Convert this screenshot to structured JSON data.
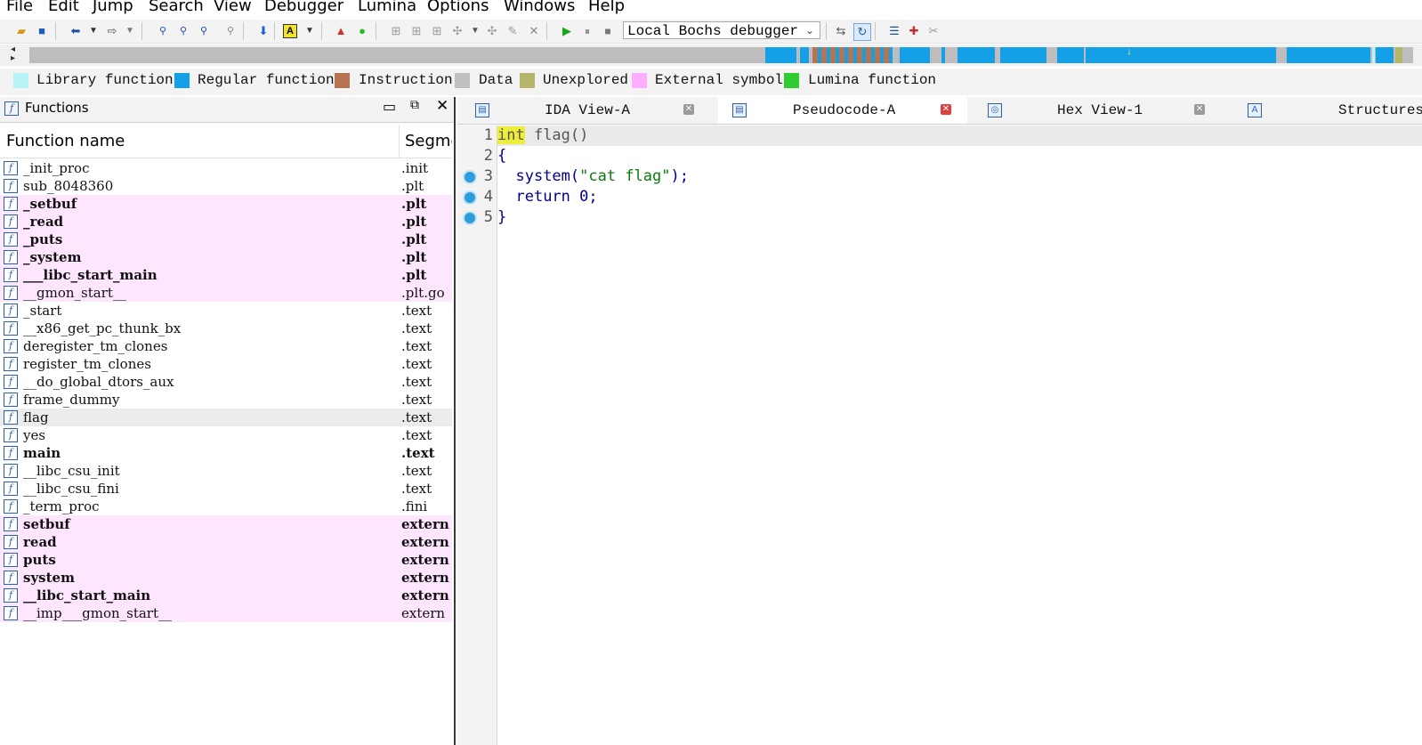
{
  "menu": [
    "File",
    "Edit",
    "Jump",
    "Search",
    "View",
    "Debugger",
    "Lumina",
    "Options",
    "Windows",
    "Help"
  ],
  "toolbar": {
    "debugger_select": "Local Bochs debugger",
    "icons": [
      "open-icon",
      "save-icon",
      "back-icon",
      "back-dropdown-icon",
      "forward-icon",
      "forward-dropdown-icon",
      "search-binary-icon",
      "search-text-icon",
      "search-immediate-icon",
      "search-sequence-icon",
      "jump-down-icon",
      "highlight-icon",
      "highlight-dropdown-icon",
      "graph-red-icon",
      "graph-green-icon",
      "debug-start-icon",
      "debug-pause-icon",
      "debug-stop-icon"
    ]
  },
  "legend": [
    {
      "label": "Library function",
      "color": "#b8f3f8"
    },
    {
      "label": "Regular function",
      "color": "#14a0e6"
    },
    {
      "label": "Instruction",
      "color": "#b87350"
    },
    {
      "label": "Data",
      "color": "#c0c0c0"
    },
    {
      "label": "Unexplored",
      "color": "#b5b56b"
    },
    {
      "label": "External symbol",
      "color": "#ffadff"
    },
    {
      "label": "Lumina function",
      "color": "#2ecc2e"
    }
  ],
  "functions_panel": {
    "title": "Functions",
    "columns": {
      "name": "Function name",
      "segment": "Segme"
    },
    "rows": [
      {
        "name": "_init_proc",
        "segment": ".init",
        "bold": false,
        "pink": false
      },
      {
        "name": "sub_8048360",
        "segment": ".plt",
        "bold": false,
        "pink": false
      },
      {
        "name": "_setbuf",
        "segment": ".plt",
        "bold": true,
        "pink": true
      },
      {
        "name": "_read",
        "segment": ".plt",
        "bold": true,
        "pink": true
      },
      {
        "name": "_puts",
        "segment": ".plt",
        "bold": true,
        "pink": true
      },
      {
        "name": "_system",
        "segment": ".plt",
        "bold": true,
        "pink": true
      },
      {
        "name": "___libc_start_main",
        "segment": ".plt",
        "bold": true,
        "pink": true
      },
      {
        "name": "__gmon_start__",
        "segment": ".plt.go",
        "bold": false,
        "pink": true
      },
      {
        "name": "_start",
        "segment": ".text",
        "bold": false,
        "pink": false
      },
      {
        "name": "__x86_get_pc_thunk_bx",
        "segment": ".text",
        "bold": false,
        "pink": false
      },
      {
        "name": "deregister_tm_clones",
        "segment": ".text",
        "bold": false,
        "pink": false
      },
      {
        "name": "register_tm_clones",
        "segment": ".text",
        "bold": false,
        "pink": false
      },
      {
        "name": "__do_global_dtors_aux",
        "segment": ".text",
        "bold": false,
        "pink": false
      },
      {
        "name": "frame_dummy",
        "segment": ".text",
        "bold": false,
        "pink": false
      },
      {
        "name": "flag",
        "segment": ".text",
        "bold": false,
        "pink": false,
        "selected": true
      },
      {
        "name": "yes",
        "segment": ".text",
        "bold": false,
        "pink": false
      },
      {
        "name": "main",
        "segment": ".text",
        "bold": true,
        "pink": false
      },
      {
        "name": "__libc_csu_init",
        "segment": ".text",
        "bold": false,
        "pink": false
      },
      {
        "name": "__libc_csu_fini",
        "segment": ".text",
        "bold": false,
        "pink": false
      },
      {
        "name": "_term_proc",
        "segment": ".fini",
        "bold": false,
        "pink": false
      },
      {
        "name": "setbuf",
        "segment": "extern",
        "bold": true,
        "pink": true
      },
      {
        "name": "read",
        "segment": "extern",
        "bold": true,
        "pink": true
      },
      {
        "name": "puts",
        "segment": "extern",
        "bold": true,
        "pink": true
      },
      {
        "name": "system",
        "segment": "extern",
        "bold": true,
        "pink": true
      },
      {
        "name": "__libc_start_main",
        "segment": "extern",
        "bold": true,
        "pink": true
      },
      {
        "name": "__imp___gmon_start__",
        "segment": "extern",
        "bold": false,
        "pink": true
      }
    ]
  },
  "tabs": [
    {
      "label": "IDA View-A",
      "icon": "ida-view-icon",
      "closable": true,
      "active": false
    },
    {
      "label": "Pseudocode-A",
      "icon": "pseudocode-icon",
      "closable": true,
      "active": true
    },
    {
      "label": "Hex View-1",
      "icon": "hex-view-icon",
      "closable": true,
      "active": false
    },
    {
      "label": "Structures",
      "icon": "structures-icon",
      "closable": false,
      "active": false
    }
  ],
  "pseudocode": {
    "line_numbers": [
      "1",
      "2",
      "3",
      "4",
      "5"
    ],
    "lines": [
      {
        "kw": "int",
        "rest": " flag()"
      },
      {
        "text": "{"
      },
      {
        "indent": "  ",
        "fn": "system(",
        "str": "\"cat flag\"",
        "tail": ");"
      },
      {
        "indent": "  ",
        "fn": "return 0;"
      },
      {
        "text": "}"
      }
    ],
    "breakpoint_lines": [
      3,
      4,
      5
    ]
  }
}
